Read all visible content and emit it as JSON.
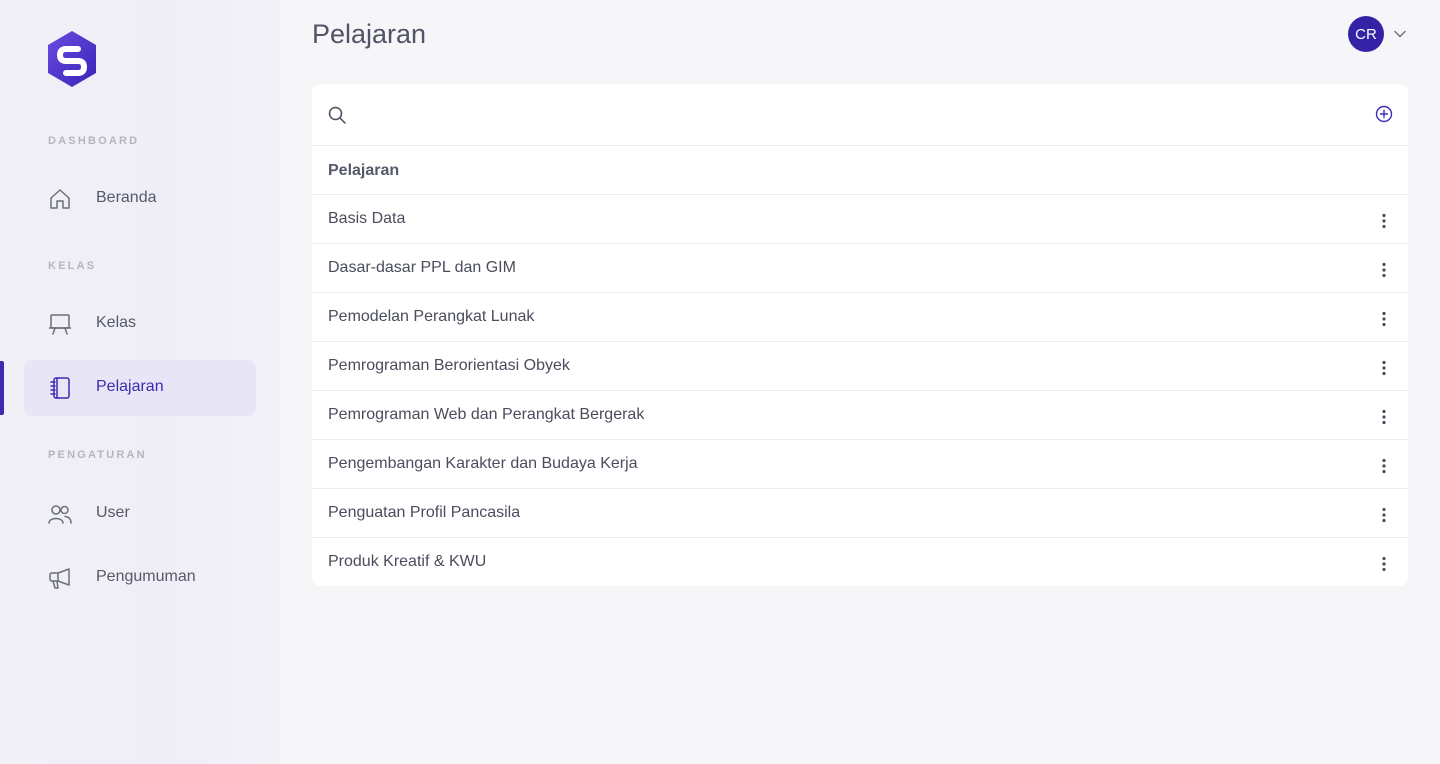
{
  "header": {
    "title": "Pelajaran",
    "avatar_initials": "CR"
  },
  "sidebar": {
    "sections": [
      {
        "label": "DASHBOARD"
      },
      {
        "label": "KELAS"
      },
      {
        "label": "PENGATURAN"
      }
    ],
    "items": [
      {
        "label": "Beranda",
        "icon": "home-icon"
      },
      {
        "label": "Kelas",
        "icon": "easel-icon"
      },
      {
        "label": "Pelajaran",
        "icon": "notebook-icon",
        "active": true
      },
      {
        "label": "User",
        "icon": "users-icon"
      },
      {
        "label": "Pengumuman",
        "icon": "megaphone-icon"
      }
    ]
  },
  "search": {
    "placeholder": "",
    "value": ""
  },
  "table": {
    "header": "Pelajaran",
    "rows": [
      "Basis Data",
      "Dasar-dasar PPL dan GIM",
      "Pemodelan Perangkat Lunak",
      "Pemrograman Berorientasi Obyek",
      "Pemrograman Web dan Perangkat Bergerak",
      "Pengembangan Karakter dan Budaya Kerja",
      "Penguatan Profil Pancasila",
      "Produk Kreatif & KWU"
    ]
  },
  "colors": {
    "accent": "#3b2cb0",
    "avatar_bg": "#3423a6",
    "logo": "#5b3fd6"
  }
}
